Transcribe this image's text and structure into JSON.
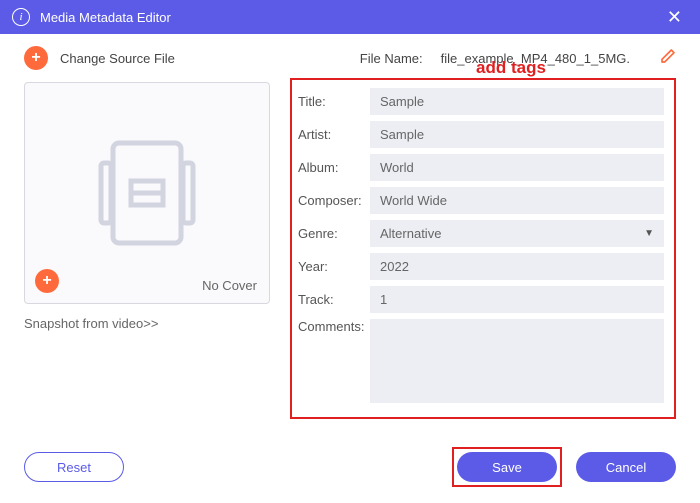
{
  "window": {
    "title": "Media Metadata Editor"
  },
  "toolbar": {
    "change_source": "Change Source File",
    "file_name_label": "File Name:",
    "file_name_value": "file_example_MP4_480_1_5MG."
  },
  "cover": {
    "no_cover": "No Cover",
    "snapshot_link": "Snapshot from video>>"
  },
  "callout": "add tags",
  "form": {
    "title_label": "Title:",
    "title_value": "Sample",
    "artist_label": "Artist:",
    "artist_value": "Sample",
    "album_label": "Album:",
    "album_value": "World",
    "composer_label": "Composer:",
    "composer_value": "World Wide",
    "genre_label": "Genre:",
    "genre_value": "Alternative",
    "year_label": "Year:",
    "year_value": "2022",
    "track_label": "Track:",
    "track_value": "1",
    "comments_label": "Comments:",
    "comments_value": ""
  },
  "buttons": {
    "reset": "Reset",
    "save": "Save",
    "cancel": "Cancel"
  }
}
